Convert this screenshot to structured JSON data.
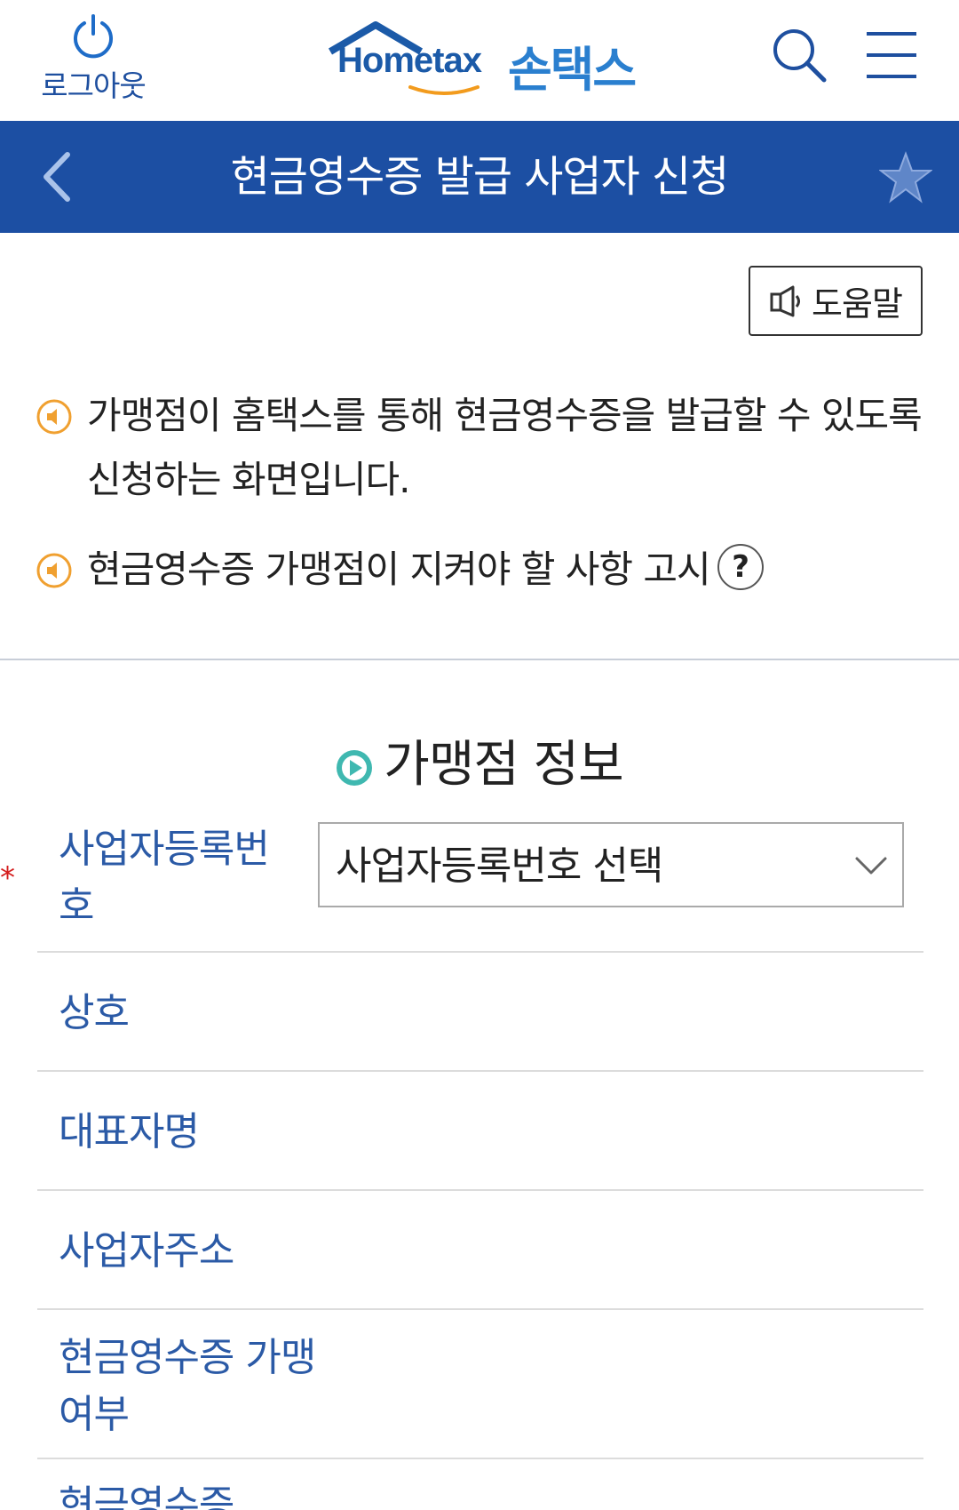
{
  "header": {
    "logout_label": "로그아웃",
    "logo_en": "Hometax",
    "logo_ko": "손택스"
  },
  "titlebar": {
    "title": "현금영수증 발급 사업자 신청"
  },
  "help": {
    "label": "도움말"
  },
  "notices": [
    "가맹점이 홈택스를 통해 현금영수증을 발급할 수 있도록 신청하는 화면입니다.",
    "현금영수증 가맹점이 지켜야 할 사항 고시"
  ],
  "help_glyph": "?",
  "section": {
    "title": "가맹점 정보"
  },
  "form": {
    "required_mark": "*",
    "biz_reg_label": "사업자등록번호",
    "biz_reg_select": "사업자등록번호 선택",
    "name_label": "상호",
    "rep_label": "대표자명",
    "addr_label": "사업자주소",
    "member_label": "현금영수증 가맹여부",
    "last_label": "현금영수증"
  },
  "colors": {
    "brand_blue": "#1c4fa3",
    "label_blue": "#2b5aa6",
    "bullet_orange": "#f0a030",
    "section_icon_teal": "#3fb8b0",
    "required_red": "#d41c1c"
  }
}
